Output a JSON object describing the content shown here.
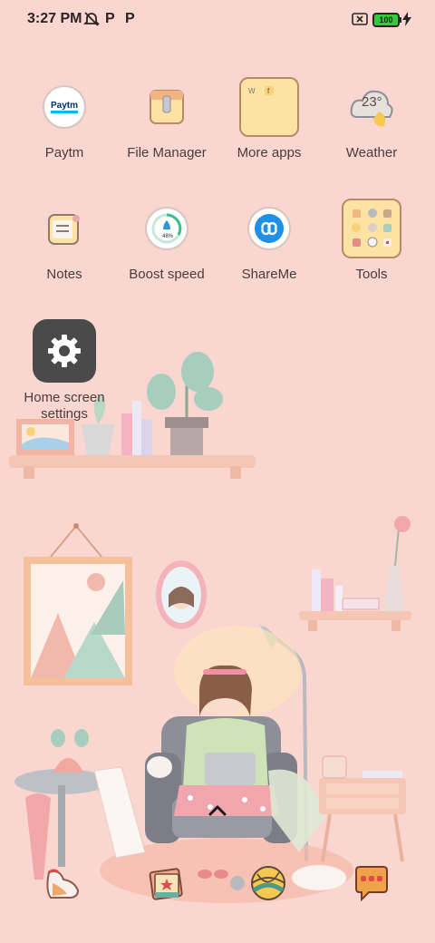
{
  "status_bar": {
    "time": "3:27 PM",
    "battery_level": "100",
    "icons": [
      "alarm-off-icon",
      "paytm-p-icon",
      "paytm-p-icon",
      "no-sim-icon",
      "battery-icon",
      "charging-bolt-icon"
    ]
  },
  "apps": {
    "paytm": {
      "label": "Paytm",
      "icon_text": "Paytm"
    },
    "file_manager": {
      "label": "File Manager"
    },
    "more_apps": {
      "label": "More apps"
    },
    "weather": {
      "label": "Weather",
      "temperature": "23°"
    },
    "notes": {
      "label": "Notes"
    },
    "boost_speed": {
      "label": "Boost speed",
      "percent": "48%"
    },
    "shareme": {
      "label": "ShareMe"
    },
    "tools": {
      "label": "Tools"
    },
    "home_screen_settings": {
      "label_line1": "Home screen",
      "label_line2": "settings"
    }
  },
  "dock": {
    "icons": [
      "sneaker-icon",
      "photo-book-icon",
      "yarn-ball-icon",
      "message-bubble-icon"
    ]
  },
  "colors": {
    "background": "#f9d6cf",
    "battery_green": "#2ecc40",
    "shareme_blue": "#1e90e6",
    "paytm_blue": "#002e6e"
  }
}
